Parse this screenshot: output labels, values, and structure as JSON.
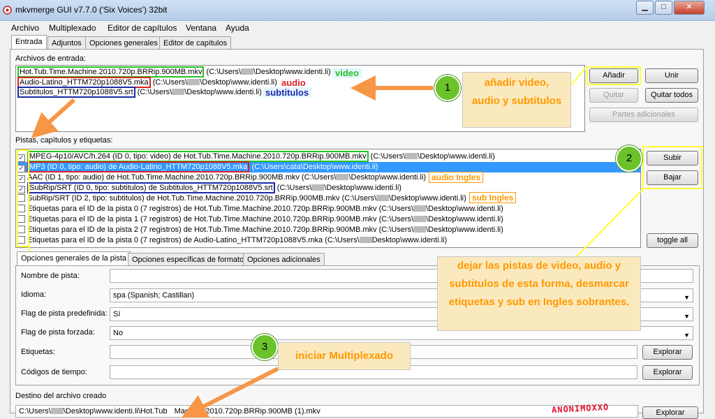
{
  "window": {
    "title": "mkvmerge GUI v7.7.0 ('Six Voices') 32bit",
    "min_label": "▁",
    "max_label": "□",
    "close_label": "✕"
  },
  "menu": [
    "Archivo",
    "Multiplexado",
    "Editor de capítulos",
    "Ventana",
    "Ayuda"
  ],
  "main_tabs": [
    "Entrada",
    "Adjuntos",
    "Opciones generales",
    "Editor de capítulos"
  ],
  "input_files": {
    "label": "Archivos de entrada:",
    "files": [
      {
        "name": "Hot.Tub.Time.Machine.2010.720p.BRRip.900MB.mkv",
        "path_pre": "(C:\\Users\\",
        "path_post": "\\Desktop\\www.identi.li)"
      },
      {
        "name": "Audio-Latino_HTTM720p1088V5.mka",
        "path_pre": "(C:\\Users\\",
        "path_post": "\\Desktop\\www.identi.li)"
      },
      {
        "name": "Subtitulos_HTTM720p1088V5.srt",
        "path_pre": "(C:\\Users\\",
        "path_post": "\\Desktop\\www.identi.li)"
      }
    ],
    "buttons": {
      "add": "Añadir",
      "join": "Unir",
      "remove": "Quitar",
      "remove_all": "Quitar todos",
      "additional_parts": "Partes adicionales"
    }
  },
  "tracks": {
    "label": "Pistas, capítulos y etiquetas:",
    "items": [
      {
        "checked": true,
        "text": "MPEG-4p10/AVC/h.264 (ID 0, tipo: video) de Hot.Tub.Time.Machine.2010.720p.BRRip.900MB.mkv",
        "path": "(C:\\Users\\",
        "path_post": "\\Desktop\\www.identi.li)"
      },
      {
        "checked": true,
        "text": "MP3 (ID 0, tipo: audio) de Audio-Latino_HTTM720p1088V5.mka",
        "path": "(C:\\Users\\cata\\Desktop\\www.identi.li)",
        "path_post": ""
      },
      {
        "checked": true,
        "text": "AAC (ID 1, tipo: audio) de Hot.Tub.Time.Machine.2010.720p.BRRip.900MB.mkv (C:\\Users\\",
        "path": "",
        "path_post": "\\Desktop\\www.identi.li)"
      },
      {
        "checked": true,
        "text": "SubRip/SRT (ID 0, tipo: subtitulos) de Subtitulos_HTTM720p1088V5.srt",
        "path": "(C:\\Users\\",
        "path_post": "\\Desktop\\www.identi.li)"
      },
      {
        "checked": false,
        "text": "SubRip/SRT (ID 2, tipo: subtitulos) de Hot.Tub.Time.Machine.2010.720p.BRRip.900MB.mkv (C:\\Users\\",
        "path": "",
        "path_post": "\\Desktop\\www.identi.li)"
      },
      {
        "checked": false,
        "text": "Etiquetas para el ID de la pista 0 (7 registros) de Hot.Tub.Time.Machine.2010.720p.BRRip.900MB.mkv (C:\\Users\\",
        "path": "",
        "path_post": "\\Desktop\\www.identi.li)"
      },
      {
        "checked": false,
        "text": "Etiquetas para el ID de la pista 1 (7 registros) de Hot.Tub.Time.Machine.2010.720p.BRRip.900MB.mkv (C:\\Users\\",
        "path": "",
        "path_post": "\\Desktop\\www.identi.li)"
      },
      {
        "checked": false,
        "text": "Etiquetas para el ID de la pista 2 (7 registros) de Hot.Tub.Time.Machine.2010.720p.BRRip.900MB.mkv (C:\\Users\\",
        "path": "",
        "path_post": "\\Desktop\\www.identi.li)"
      },
      {
        "checked": false,
        "text": "Etiquetas para el ID de la pista 0 (7 registros) de Audio-Latino_HTTM720p1088V5.mka (C:\\Users\\",
        "path": "",
        "path_post": "Desktop\\www.identi.li)"
      }
    ],
    "buttons": {
      "up": "Subir",
      "down": "Bajar",
      "toggle_all": "toggle all"
    }
  },
  "track_tabs": [
    "Opciones generales de la pista",
    "Opciones específicas de formato",
    "Opciones adicionales"
  ],
  "track_options": {
    "track_name_label": "Nombre de pista:",
    "track_name_value": "",
    "language_label": "Idioma:",
    "language_value": "spa (Spanish; Castillan)",
    "default_flag_label": "Flag de pista predefinida:",
    "default_flag_value": "Sí",
    "forced_flag_label": "Flag de pista forzada:",
    "forced_flag_value": "No",
    "tags_label": "Etiquetas:",
    "tags_value": "",
    "timecodes_label": "Códigos de tiempo:",
    "timecodes_value": "",
    "browse_label": "Explorar"
  },
  "output": {
    "label": "Destino del archivo creado",
    "path": "C:\\Users\\",
    "path_mid": "\\Desktop\\www.identi.li\\Hot.Tub",
    "path_end": "Machine.2010.720p.BRRip.900MB (1).mkv",
    "browse_label": "Explorar",
    "watermark": "ANONIMOXXO"
  },
  "annotations": {
    "tag_video": "video",
    "tag_audio": "audio",
    "tag_subs": "subtitulos",
    "tag_audio_en": "audio Ingles",
    "tag_sub_en": "sub Ingles",
    "step1_number": "1",
    "step1_text": "añadir video, audio y subtitulos",
    "step2_number": "2",
    "step2_text": "dejar las pistas de video, audio y subtitulos de esta forma, desmarcar etiquetas y sub en Ingles sobrantes.",
    "step3_number": "3",
    "step3_text": "iniciar Multiplexado",
    "arrow_color": "#f79646",
    "highlight_color": "#ffff33"
  }
}
